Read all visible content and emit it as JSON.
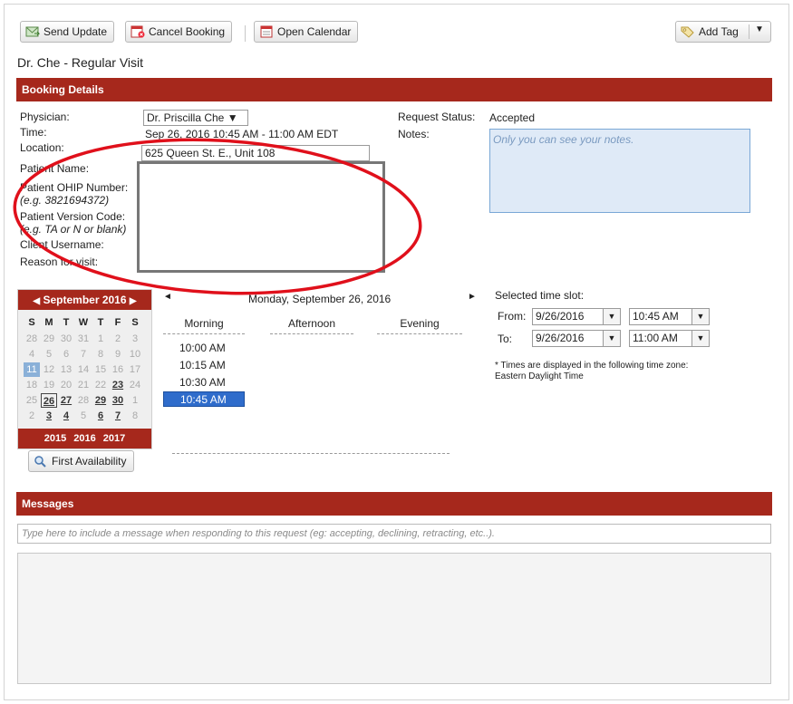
{
  "toolbar": {
    "send_update": "Send Update",
    "cancel_booking": "Cancel Booking",
    "open_calendar": "Open Calendar",
    "add_tag": "Add Tag",
    "add_tag_arrow": "▼"
  },
  "title": "Dr. Che - Regular Visit",
  "booking": {
    "header": "Booking Details",
    "physician_label": "Physician:",
    "physician_value": "Dr. Priscilla Che ▼",
    "time_label": "Time:",
    "time_value": "Sep 26, 2016 10:45 AM - 11:00 AM EDT",
    "location_label": "Location:",
    "location_value": "625 Queen St. E., Unit 108",
    "patient_name_label": "Patient Name:",
    "ohip_label": "Patient OHIP Number:",
    "ohip_hint": "(e.g. 3821694372)",
    "version_label": "Patient Version Code:",
    "version_hint": "(e.g. TA or N or blank)",
    "client_label": "Client Username:",
    "reason_label": "Reason for visit:",
    "status_label": "Request Status:",
    "status_value": "Accepted",
    "notes_label": "Notes:",
    "notes_placeholder": "Only you can see your notes."
  },
  "calendar": {
    "prev": "◀",
    "month": "September 2016",
    "next": "▶",
    "weekdays": [
      "S",
      "M",
      "T",
      "W",
      "T",
      "F",
      "S"
    ],
    "years": [
      "2015",
      "2016",
      "2017"
    ],
    "first_availability": "First Availability"
  },
  "schedule": {
    "prev": "◄",
    "date": "Monday, September 26, 2016",
    "next": "►",
    "columns": [
      "Morning",
      "Afternoon",
      "Evening"
    ],
    "slots": [
      "10:00 AM",
      "10:15 AM",
      "10:30 AM"
    ],
    "selected_slot": "10:45 AM"
  },
  "timeslot": {
    "label": "Selected time slot:",
    "from_label": "From:",
    "from_date": "9/26/2016",
    "from_time": "10:45 AM",
    "to_label": "To:",
    "to_date": "9/26/2016",
    "to_time": "11:00 AM",
    "tz_note_1": "* Times are displayed in the following time zone:",
    "tz_note_2": "Eastern Daylight Time"
  },
  "messages": {
    "header": "Messages",
    "input_placeholder": "Type here to include a message when responding to this request (eg: accepting, declining, retracting, etc..)."
  },
  "colors": {
    "header_bar": "#a6281c",
    "selected_slot": "#2f6ccb",
    "annotation_circle": "#e0101b"
  }
}
